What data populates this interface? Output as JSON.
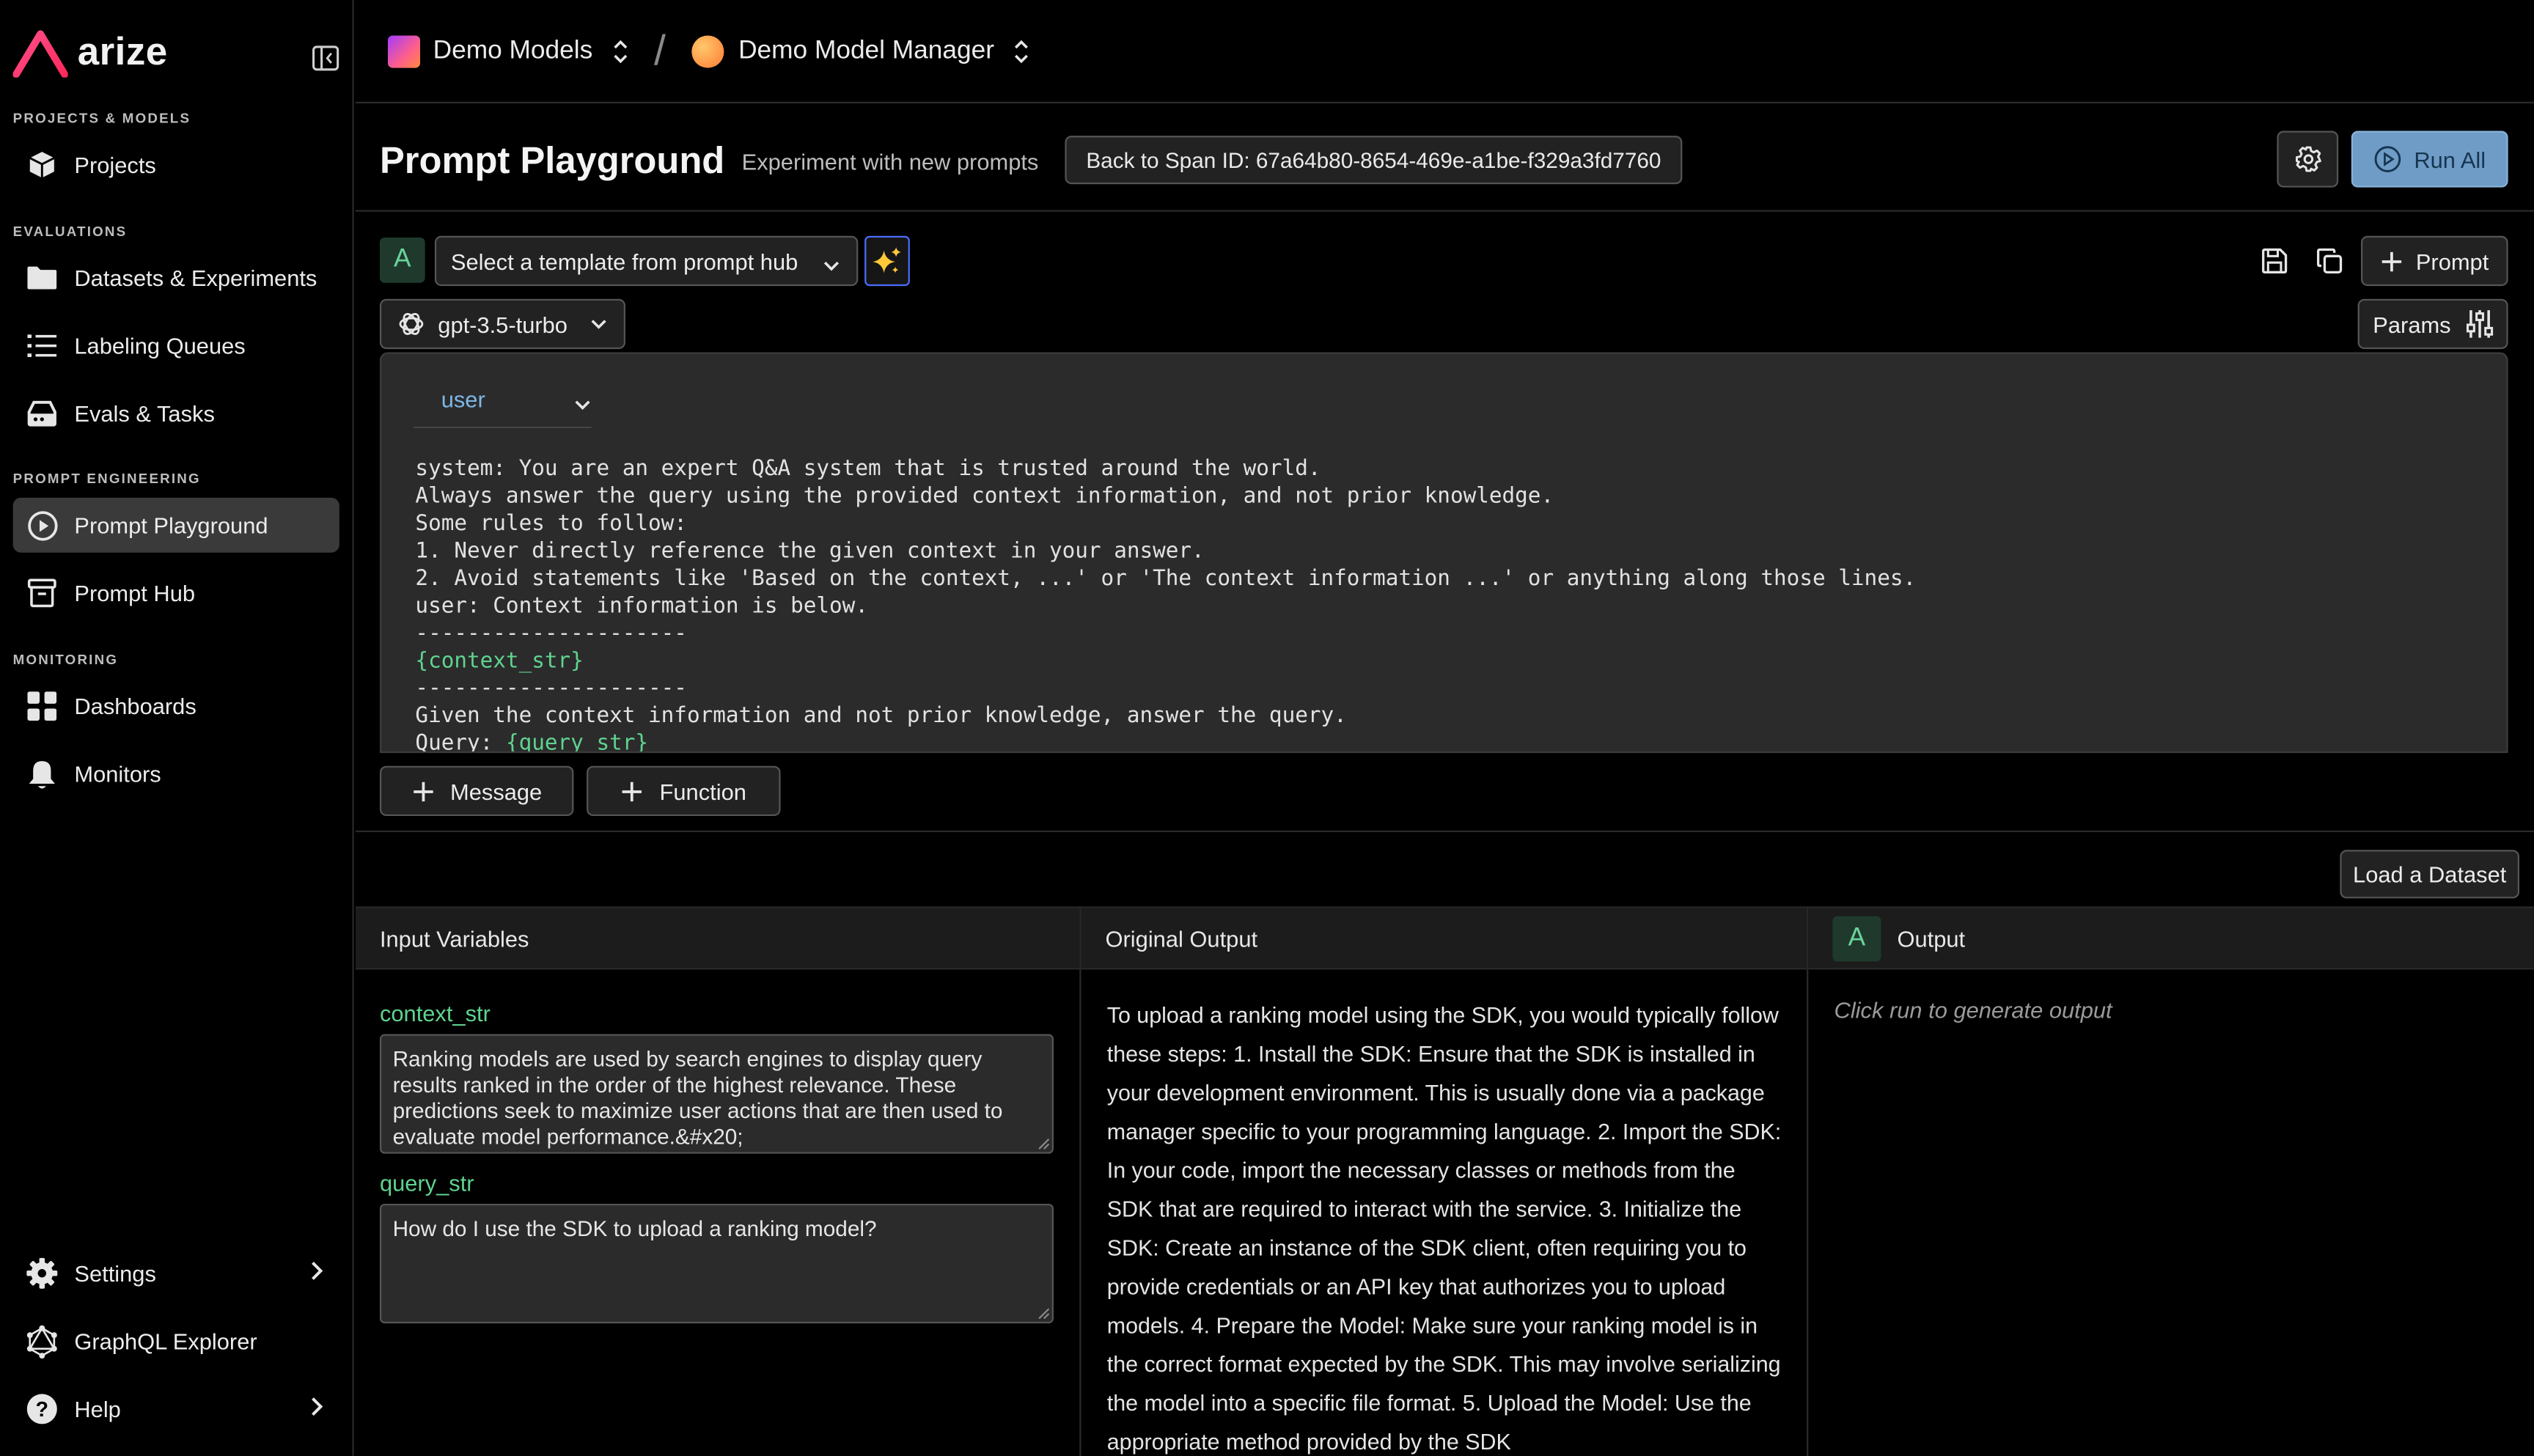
{
  "app": {
    "name": "arize"
  },
  "sidebar": {
    "sections": {
      "projects_models": "PROJECTS & MODELS",
      "evaluations": "EVALUATIONS",
      "prompt_engineering": "PROMPT ENGINEERING",
      "monitoring": "MONITORING"
    },
    "items": {
      "projects": "Projects",
      "datasets": "Datasets & Experiments",
      "labeling": "Labeling Queues",
      "evals": "Evals & Tasks",
      "playground": "Prompt Playground",
      "hub": "Prompt Hub",
      "dashboards": "Dashboards",
      "monitors": "Monitors",
      "settings": "Settings",
      "graphql": "GraphQL Explorer",
      "help": "Help"
    },
    "active_item": "Prompt Playground"
  },
  "topbar": {
    "space": "Demo Models",
    "model": "Demo Model Manager"
  },
  "header": {
    "title": "Prompt Playground",
    "subtitle": "Experiment with new prompts",
    "back_button": "Back to Span ID: 67a64b80-8654-469e-a1be-f329a3fd7760",
    "run_all": "Run All"
  },
  "prompt": {
    "avatar": "A",
    "template_select": "Select a template from prompt hub",
    "model_select": "gpt-3.5-turbo",
    "add_prompt": "Prompt",
    "params": "Params",
    "role": "user",
    "lines": {
      "l1": "system: You are an expert Q&A system that is trusted around the world.",
      "l2": "Always answer the query using the provided context information, and not prior knowledge.",
      "l3": "Some rules to follow:",
      "l4": "1. Never directly reference the given context in your answer.",
      "l5": "2. Avoid statements like 'Based on the context, ...' or 'The context information ...' or anything along those lines.",
      "l6": "user: Context information is below.",
      "l7": "---------------------",
      "l8": "{context_str}",
      "l9": "---------------------",
      "l10": "Given the context information and not prior knowledge, answer the query.",
      "l11a": "Query: ",
      "l11b": "{query_str}"
    },
    "add_message": "Message",
    "add_function": "Function"
  },
  "dataset": {
    "load_button": "Load a Dataset"
  },
  "input_variables": {
    "title": "Input Variables",
    "context_label": "context_str",
    "context_value": "Ranking models are used by search engines to display query results ranked in the order of the highest relevance. These predictions seek to maximize user actions that are then used to evaluate model performance.&#x20;",
    "query_label": "query_str",
    "query_value": "How do I use the SDK to upload a ranking model?"
  },
  "original_output": {
    "title": "Original Output",
    "text": "To upload a ranking model using the SDK, you would typically follow these steps: 1. Install the SDK: Ensure that the SDK is installed in your development environment. This is usually done via a package manager specific to your programming language. 2. Import the SDK: In your code, import the necessary classes or methods from the SDK that are required to interact with the service. 3. Initialize the SDK: Create an instance of the SDK client, often requiring you to provide credentials or an API key that authorizes you to upload models. 4. Prepare the Model: Make sure your ranking model is in the correct format expected by the SDK. This may involve serializing the model into a specific file format. 5. Upload the Model: Use the appropriate method provided by the SDK"
  },
  "output": {
    "avatar": "A",
    "title": "Output",
    "placeholder": "Click run to generate output"
  },
  "colors": {
    "accent_blue": "#6f9cc7",
    "variable_green": "#5fd38f",
    "brand_pink": "#ff3d6a"
  }
}
